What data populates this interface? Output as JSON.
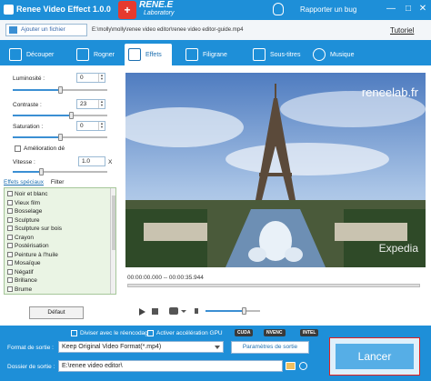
{
  "titlebar": {
    "app_title": "Renee Video Effect 1.0.0",
    "brand_name": "RENE.E",
    "brand_sub": "Laboratory",
    "bug_label": "Rapporter un bug",
    "min": "—",
    "max": "□",
    "close": "✕"
  },
  "toolbar": {
    "add_file_label": "Ajouter un fichier",
    "file_path": "E:\\molly\\molly\\renee video editor\\renee video editor-guide.mp4",
    "tutorial_label": "Tutoriel"
  },
  "tabs": [
    {
      "label": "Découper",
      "icon": "scissors-icon"
    },
    {
      "label": "Rogner",
      "icon": "crop-icon"
    },
    {
      "label": "Effets",
      "icon": "effects-icon"
    },
    {
      "label": "Filigrane",
      "icon": "watermark-icon"
    },
    {
      "label": "Sous-titres",
      "icon": "subtitles-icon"
    },
    {
      "label": "Musique",
      "icon": "music-icon"
    }
  ],
  "adjust": {
    "luminosite_label": "Luminosité :",
    "luminosite_value": "0",
    "luminosite_level": 0.5,
    "contraste_label": "Contraste :",
    "contraste_value": "23",
    "contraste_level": 0.62,
    "saturation_label": "Saturation :",
    "saturation_value": "0",
    "saturation_level": 0.5,
    "amelioration_label": "Amélioration dé",
    "vitesse_label": "Vitesse :",
    "vitesse_value": "1.0",
    "vitesse_unit": "X",
    "vitesse_level": 0.3
  },
  "effects": {
    "tab_special": "Effets spéciaux",
    "tab_filter": "Filter",
    "items": [
      "Noir et blanc",
      "Vieux film",
      "Bosselage",
      "Sculpture",
      "Sculpture sur bois",
      "Crayon",
      "Postérisation",
      "Peinture à l'huile",
      "Mosaïque",
      "Négatif",
      "Brillance",
      "Brume"
    ],
    "default_button": "Défaut"
  },
  "player": {
    "watermark": "reneelab.fr",
    "overlay_brand": "Expedia",
    "timecode": "00:00:00.000 -- 00:00:35.944",
    "progress": 0.0,
    "volume": 0.7
  },
  "bottom": {
    "split_label": "Diviser avec le réencodage",
    "gpu_label": "Activer accélération GPU",
    "gpu_badges": [
      "CUDA",
      "NVENC",
      "INTEL"
    ],
    "format_label": "Format de sortie :",
    "format_value": "Keep Original Video Format(*.mp4)",
    "params_label": "Paramètres de sortie",
    "folder_label": "Dossier de sortie :",
    "folder_value": "E:\\renee video editor\\",
    "launch_label": "Lancer"
  },
  "colors": {
    "primary": "#1e8fd8",
    "launch": "#56aee6",
    "launch_border": "#e02020"
  }
}
